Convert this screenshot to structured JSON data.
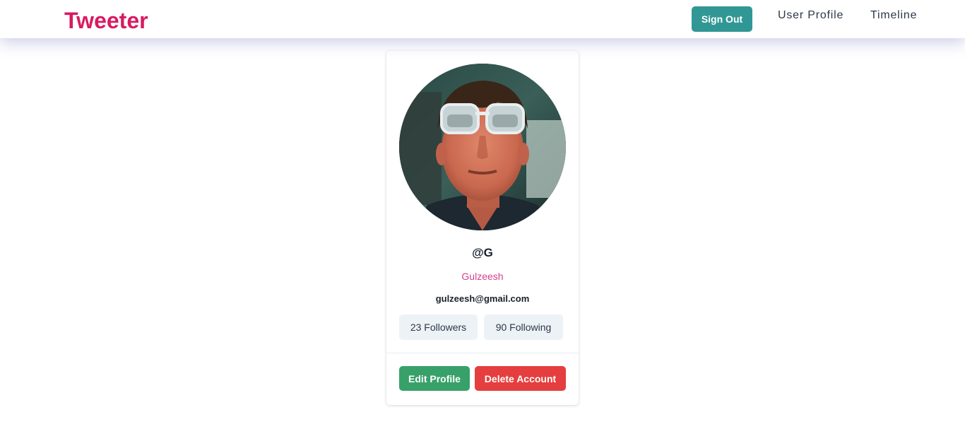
{
  "nav": {
    "brand": "Tweeter",
    "signout_label": "Sign Out",
    "links": [
      {
        "label": "User Profile"
      },
      {
        "label": "Timeline"
      }
    ]
  },
  "profile": {
    "avatar_icon": "user-avatar-photo",
    "handle": "@G",
    "name": "Gulzeesh",
    "email": "gulzeesh@gmail.com",
    "followers_label": "23 Followers",
    "following_label": "90 Following",
    "edit_label": "Edit Profile",
    "delete_label": "Delete Account"
  },
  "colors": {
    "brand": "#d81b60",
    "signout": "#319795",
    "name": "#d53f8c",
    "edit": "#38a169",
    "delete": "#e53e3e",
    "badge_bg": "#edf2f7"
  }
}
